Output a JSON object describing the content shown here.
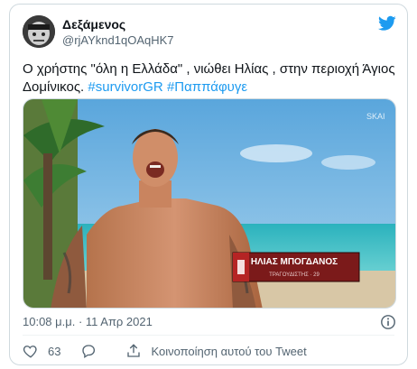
{
  "user": {
    "display_name": "Δεξάμενος",
    "handle": "@rjAYknd1qOAqHK7"
  },
  "tweet": {
    "text_main": "Ο χρήστης \"όλη η Ελλάδα\" , νιώθει Ηλίας , στην περιοχή Άγιος Δομίνικος. ",
    "hashtags": [
      "#survivorGR",
      "#Παππάφυγε"
    ],
    "timestamp": "10:08 μ.μ. · 11 Απρ 2021"
  },
  "media": {
    "caption_name": "ΗΛΙΑΣ ΜΠΟΓΔΑΝΟΣ",
    "caption_sub": "ΤΡΑΓΟΥΔΙΣΤΗΣ · 29",
    "channel_logo": "SKAI"
  },
  "actions": {
    "likes": "63",
    "share_label": "Κοινοποίηση αυτού του Tweet"
  },
  "colors": {
    "accent": "#1d9bf0",
    "text": "#0f1419",
    "muted": "#536471"
  },
  "icons": [
    "twitter-bird-icon",
    "info-icon",
    "heart-icon",
    "reply-icon",
    "share-icon"
  ]
}
